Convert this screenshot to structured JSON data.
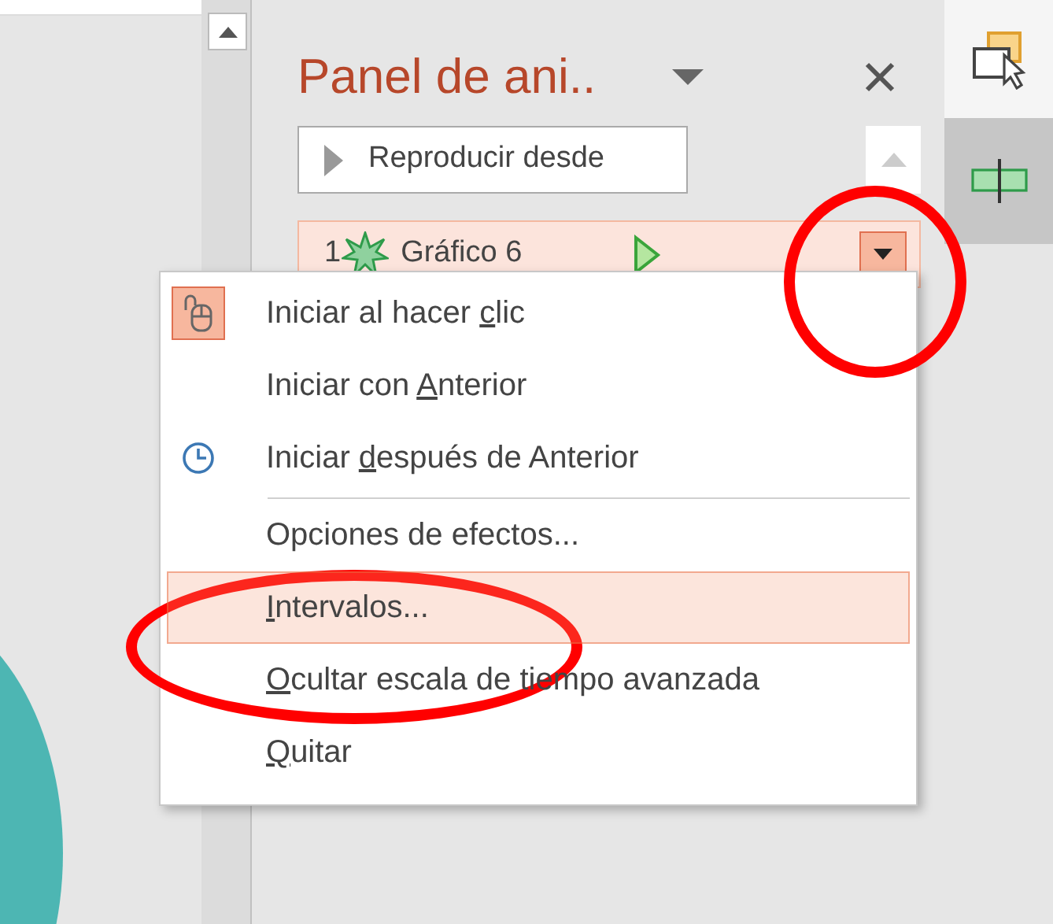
{
  "panel": {
    "title": "Panel de ani..",
    "play_button": "Reproducir desde",
    "items": [
      {
        "number": "1",
        "name": "Gráfico 6",
        "selected": true
      }
    ]
  },
  "context_menu": {
    "groups": [
      [
        {
          "checked": true,
          "selected": false,
          "label": {
            "text_before": "Iniciar al hacer ",
            "access_key": "c",
            "text_after": "lic"
          }
        },
        {
          "checked": false,
          "selected": false,
          "label": {
            "text_before": "Iniciar con ",
            "access_key": "A",
            "text_after": "nterior"
          }
        },
        {
          "checked": false,
          "selected": false,
          "label": {
            "text_before": "Iniciar ",
            "access_key": "d",
            "text_after": "espués de Anterior"
          }
        }
      ],
      [
        {
          "checked": false,
          "selected": false,
          "label": {
            "text_before": "Opciones de efectos..."
          }
        },
        {
          "checked": false,
          "selected": true,
          "label": {
            "access_key": "I",
            "text_after": "ntervalos..."
          }
        },
        {
          "checked": false,
          "selected": false,
          "label": {
            "access_key": "O",
            "text_after": "cultar escala de tiempo avanzada"
          }
        },
        {
          "checked": false,
          "selected": false,
          "label": {
            "access_key": "Q",
            "text_after": "uitar"
          }
        }
      ]
    ]
  },
  "toolbar": [
    {
      "selected": false
    },
    {
      "selected": true
    }
  ],
  "annotations": [
    {
      "kind": "circle"
    },
    {
      "kind": "ellipse"
    }
  ]
}
